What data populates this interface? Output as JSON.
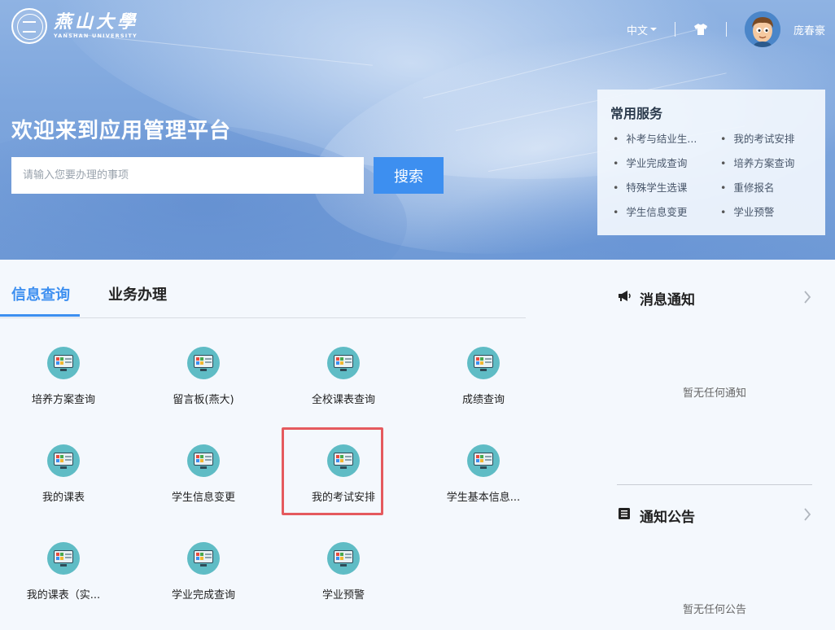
{
  "header": {
    "logo_cn": "燕山大學",
    "logo_en": "YANSHAN UNIVERSITY",
    "language": "中文",
    "username": "庞春豪"
  },
  "hero": {
    "welcome": "欢迎来到应用管理平台",
    "search_placeholder": "请输入您要办理的事项",
    "search_button": "搜索"
  },
  "services": {
    "title": "常用服务",
    "items": [
      "补考与结业生...",
      "我的考试安排",
      "学业完成查询",
      "培养方案查询",
      "特殊学生选课",
      "重修报名",
      "学生信息变更",
      "学业预警"
    ]
  },
  "tabs": [
    {
      "label": "信息查询",
      "active": true
    },
    {
      "label": "业务办理",
      "active": false
    }
  ],
  "apps": [
    {
      "label": "培养方案查询",
      "icon": "monitor-icon"
    },
    {
      "label": "留言板(燕大)",
      "icon": "monitor-icon"
    },
    {
      "label": "全校课表查询",
      "icon": "monitor-icon"
    },
    {
      "label": "成绩查询",
      "icon": "monitor-icon"
    },
    {
      "label": "我的课表",
      "icon": "monitor-icon"
    },
    {
      "label": "学生信息变更",
      "icon": "monitor-icon"
    },
    {
      "label": "我的考试安排",
      "icon": "monitor-icon",
      "highlighted": true
    },
    {
      "label": "学生基本信息...",
      "icon": "monitor-icon"
    },
    {
      "label": "我的课表（实...",
      "icon": "monitor-icon"
    },
    {
      "label": "学业完成查询",
      "icon": "monitor-icon"
    },
    {
      "label": "学业预警",
      "icon": "monitor-icon"
    }
  ],
  "notices": {
    "title": "消息通知",
    "empty": "暂无任何通知",
    "icon": "megaphone-icon"
  },
  "announcements": {
    "title": "通知公告",
    "empty": "暂无任何公告",
    "icon": "document-list-icon"
  },
  "colors": {
    "accent": "#3d8ff0",
    "icon_bg": "#5fbcc5",
    "highlight": "#e55a5e"
  }
}
